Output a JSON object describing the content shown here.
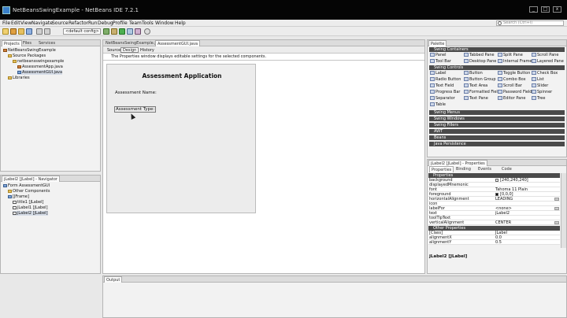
{
  "window": {
    "title": "NetBeansSwingExample - NetBeans IDE 7.2.1"
  },
  "menu": [
    "File",
    "Edit",
    "View",
    "Navigate",
    "Source",
    "Refactor",
    "Run",
    "Debug",
    "Profile",
    "Team",
    "Tools",
    "Window",
    "Help"
  ],
  "search": {
    "placeholder": "Search (Ctrl+I)"
  },
  "toolbar": {
    "config": "<default config>"
  },
  "projects": {
    "tabs": [
      "Projects",
      "Files",
      "Services"
    ],
    "tree": [
      "NetBeansSwingExample",
      "Source Packages",
      "netbeansswingexample",
      "AssessmentApp.java",
      "AssessmentGUI.java",
      "Libraries"
    ]
  },
  "navigator": {
    "title": "jLabel2 [JLabel] - Navigator",
    "tree": [
      "Form AssessmentGUI",
      "Other Components",
      "[JFrame]",
      "title1 [JLabel]",
      "jLabel1 [JLabel]",
      "jLabel2 [JLabel]"
    ]
  },
  "editor": {
    "tabs": [
      "NetBeansSwingExample.java",
      "AssessmentGUI.java"
    ],
    "buttons": [
      "Source",
      "Design",
      "History"
    ],
    "info": "The Properties window displays editable settings for the selected components.",
    "form": {
      "heading": "Assessment Application",
      "label1": "Assessment Name:",
      "label2": "Assessment Type:"
    }
  },
  "palette": {
    "title": "Palette",
    "categories": [
      "Swing Containers",
      "Swing Controls",
      "Swing Menus",
      "Swing Windows",
      "Swing Fillers",
      "AWT",
      "Beans",
      "Java Persistence"
    ],
    "containers": [
      "Panel",
      "Tabbed Pane",
      "Split Pane",
      "Scroll Pane",
      "Tool Bar",
      "Desktop Pane",
      "Internal Frame",
      "Layered Pane"
    ],
    "controls": [
      "Label",
      "Button",
      "Toggle Button",
      "Check Box",
      "Radio Button",
      "Button Group",
      "Combo Box",
      "List",
      "Text Field",
      "Text Area",
      "Scroll Bar",
      "Slider",
      "Progress Bar",
      "Formatted Field",
      "Password Field",
      "Spinner",
      "Separator",
      "Text Pane",
      "Editor Pane",
      "Tree",
      "Table"
    ]
  },
  "properties": {
    "title": "jLabel2 [JLabel] - Properties",
    "tabs": [
      "Properties",
      "Binding",
      "Events",
      "Code"
    ],
    "group1": "Properties",
    "rows": [
      {
        "k": "background",
        "v": "[240,240,240]"
      },
      {
        "k": "displayedMnemonic",
        "v": ""
      },
      {
        "k": "font",
        "v": "Tahoma 11 Plain"
      },
      {
        "k": "foreground",
        "v": "[0,0,0]"
      },
      {
        "k": "horizontalAlignment",
        "v": "LEADING"
      },
      {
        "k": "icon",
        "v": ""
      },
      {
        "k": "labelFor",
        "v": "<none>"
      },
      {
        "k": "text",
        "v": "jLabel2"
      },
      {
        "k": "toolTipText",
        "v": ""
      },
      {
        "k": "verticalAlignment",
        "v": "CENTER"
      }
    ],
    "group2": "Other Properties",
    "rows2": [
      {
        "k": "[Class]",
        "v": "JLabel"
      },
      {
        "k": "alignmentX",
        "v": "0.0"
      },
      {
        "k": "alignmentY",
        "v": "0.5"
      }
    ],
    "footer": "jLabel2 [JLabel]"
  },
  "output": {
    "title": "Output"
  }
}
